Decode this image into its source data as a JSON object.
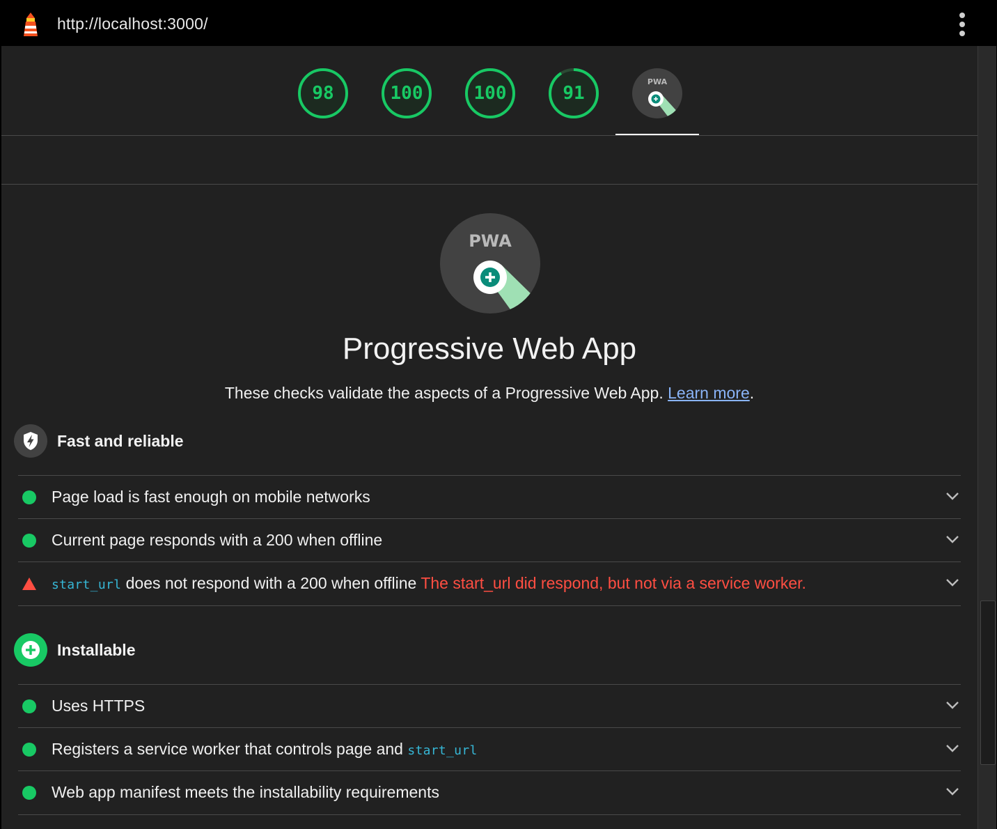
{
  "topbar": {
    "url": "http://localhost:3000/",
    "logo_icon": "lighthouse-icon",
    "menu_icon": "more-vert-icon"
  },
  "gauges": [
    {
      "id": "performance",
      "score": "98"
    },
    {
      "id": "accessibility",
      "score": "100"
    },
    {
      "id": "best-practices",
      "score": "100"
    },
    {
      "id": "seo",
      "score": "91"
    },
    {
      "id": "pwa",
      "badge": "PWA",
      "selected": true
    }
  ],
  "category": {
    "badge": "PWA",
    "title": "Progressive Web App",
    "description": "These checks validate the aspects of a Progressive Web App.",
    "learn_more": "Learn more",
    "period": "."
  },
  "groups": {
    "fast_reliable": {
      "title": "Fast and reliable",
      "icon": "lightning-shield-icon",
      "audits": [
        {
          "status": "pass",
          "title": "Page load is fast enough on mobile networks"
        },
        {
          "status": "pass",
          "title": "Current page responds with a 200 when offline"
        },
        {
          "status": "fail",
          "code": "start_url",
          "title": "does not respond with a 200 when offline",
          "explanation": "The start_url did respond, but not via a service worker."
        }
      ]
    },
    "installable": {
      "title": "Installable",
      "icon": "plus-circle-icon",
      "audits": [
        {
          "status": "pass",
          "title": "Uses HTTPS"
        },
        {
          "status": "pass",
          "title": "Registers a service worker that controls page and",
          "code": "start_url"
        },
        {
          "status": "pass",
          "title": "Web app manifest meets the installability requirements"
        }
      ]
    }
  },
  "colors": {
    "pass": "#18c964",
    "fail": "#ff4e42",
    "link": "#8ab4f8",
    "code": "#36b7d6",
    "background": "#212121"
  }
}
